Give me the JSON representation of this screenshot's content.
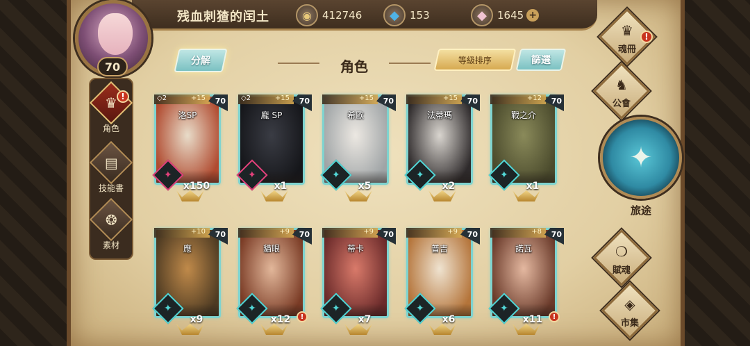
{
  "player": {
    "name": "残血刺猹的闰土",
    "level": "70"
  },
  "currencies": [
    {
      "name": "gold",
      "value": "412746",
      "color": "#d8b46a"
    },
    {
      "name": "blue-crystal",
      "value": "153",
      "color": "#4fb3e6"
    },
    {
      "name": "pink-crystal",
      "value": "1645",
      "color": "#f1c4d3"
    }
  ],
  "sidebar": {
    "items": [
      {
        "label": "角色",
        "active": true,
        "alert": "!"
      },
      {
        "label": "技能書",
        "active": false
      },
      {
        "label": "素材",
        "active": false
      }
    ]
  },
  "header": {
    "decompose_label": "分解",
    "title": "角色",
    "sort_label": "等級排序",
    "filter_label": "篩選"
  },
  "cards": [
    {
      "name": "洛SP",
      "stars": "◇2",
      "plus": "+15",
      "level": "70",
      "count": "x150",
      "skill_color": "#e0417a",
      "art": "#e8dcc9,#b04a2f"
    },
    {
      "name": "龐 SP",
      "stars": "◇2",
      "plus": "+15",
      "level": "70",
      "count": "x1",
      "skill_color": "#e0417a",
      "art": "#3a3c44,#15161a"
    },
    {
      "name": "希歐",
      "stars": "",
      "plus": "+15",
      "level": "70",
      "count": "x5",
      "skill_color": "#52d6d6",
      "art": "#ece8e2,#9fa4a6"
    },
    {
      "name": "法蒂瑪",
      "stars": "",
      "plus": "+15",
      "level": "70",
      "count": "x2",
      "skill_color": "#52d6d6",
      "art": "#d9d5cf,#2e2a2b"
    },
    {
      "name": "戰之介",
      "stars": "",
      "plus": "+12",
      "level": "70",
      "count": "x1",
      "skill_color": "#52d6d6",
      "art": "#8a8a5a,#4a4a2c"
    },
    {
      "name": "應",
      "stars": "",
      "plus": "+10",
      "level": "70",
      "count": "x9",
      "skill_color": "#52d6d6",
      "art": "#c08a4a,#4d3a22"
    },
    {
      "name": "貓眼",
      "stars": "",
      "plus": "+9",
      "level": "70",
      "count": "x12",
      "skill_color": "#52d6d6",
      "art": "#e2b79a,#7a3b25",
      "alert": "!"
    },
    {
      "name": "蒂卡",
      "stars": "",
      "plus": "+9",
      "level": "70",
      "count": "x7",
      "skill_color": "#52d6d6",
      "art": "#d97a6a,#6a2a2a"
    },
    {
      "name": "普吉",
      "stars": "",
      "plus": "+9",
      "level": "70",
      "count": "x6",
      "skill_color": "#52d6d6",
      "art": "#efe3d0,#b4743a"
    },
    {
      "name": "諾瓦",
      "stars": "",
      "plus": "+8",
      "level": "70",
      "count": "x11",
      "skill_color": "#52d6d6",
      "art": "#e4b8a0,#6a3a2a",
      "alert": "!"
    }
  ],
  "right_menu": {
    "soul_book": "魂冊",
    "guild": "公會",
    "journey": "旅途",
    "talent": "賦魂",
    "market": "市集",
    "alert": "!"
  }
}
